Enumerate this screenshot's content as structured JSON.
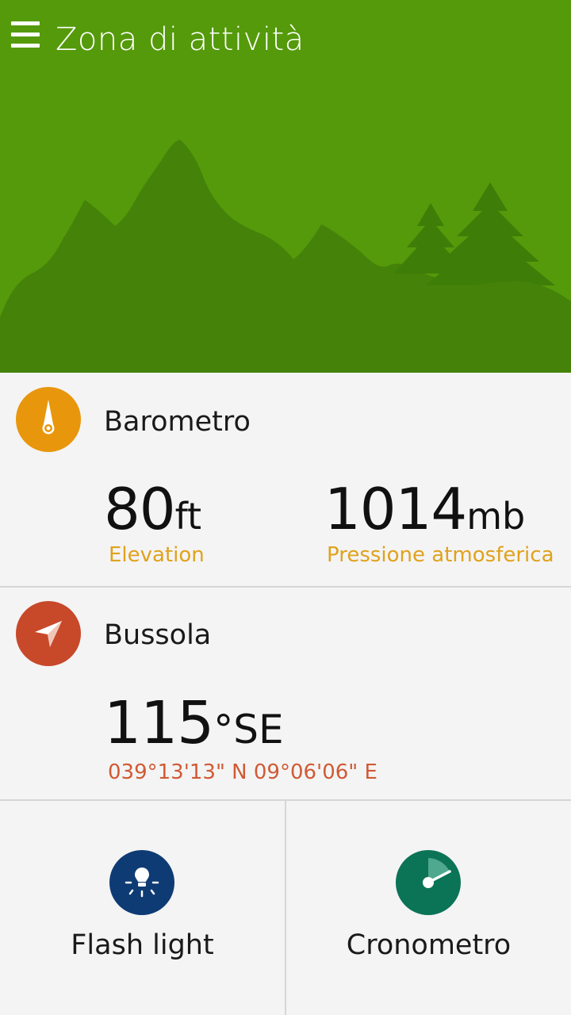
{
  "app": {
    "title": "Zona di attività",
    "menu_icon": "hamburger-menu-icon",
    "header_color": "#549a0a"
  },
  "barometer": {
    "title": "Barometro",
    "icon": "barometer-needle-icon",
    "icon_color": "#e8960c",
    "elevation": {
      "value": "80",
      "unit": "ft",
      "label": "Elevation"
    },
    "pressure": {
      "value": "1014",
      "unit": "mb",
      "label": "Pressione atmosferica"
    },
    "label_color": "#e0a21d"
  },
  "compass": {
    "title": "Bussola",
    "icon": "compass-arrow-icon",
    "icon_color": "#c8482a",
    "heading": {
      "value": "115",
      "unit": "°SE"
    },
    "coordinates": "039°13'13\" N 09°06'06\" E",
    "label_color": "#d05a34"
  },
  "tiles": [
    {
      "label": "Flash light",
      "icon": "flashlight-bulb-icon",
      "color": "#0e3b73"
    },
    {
      "label": "Cronometro",
      "icon": "stopwatch-icon",
      "color": "#0b7356"
    }
  ]
}
